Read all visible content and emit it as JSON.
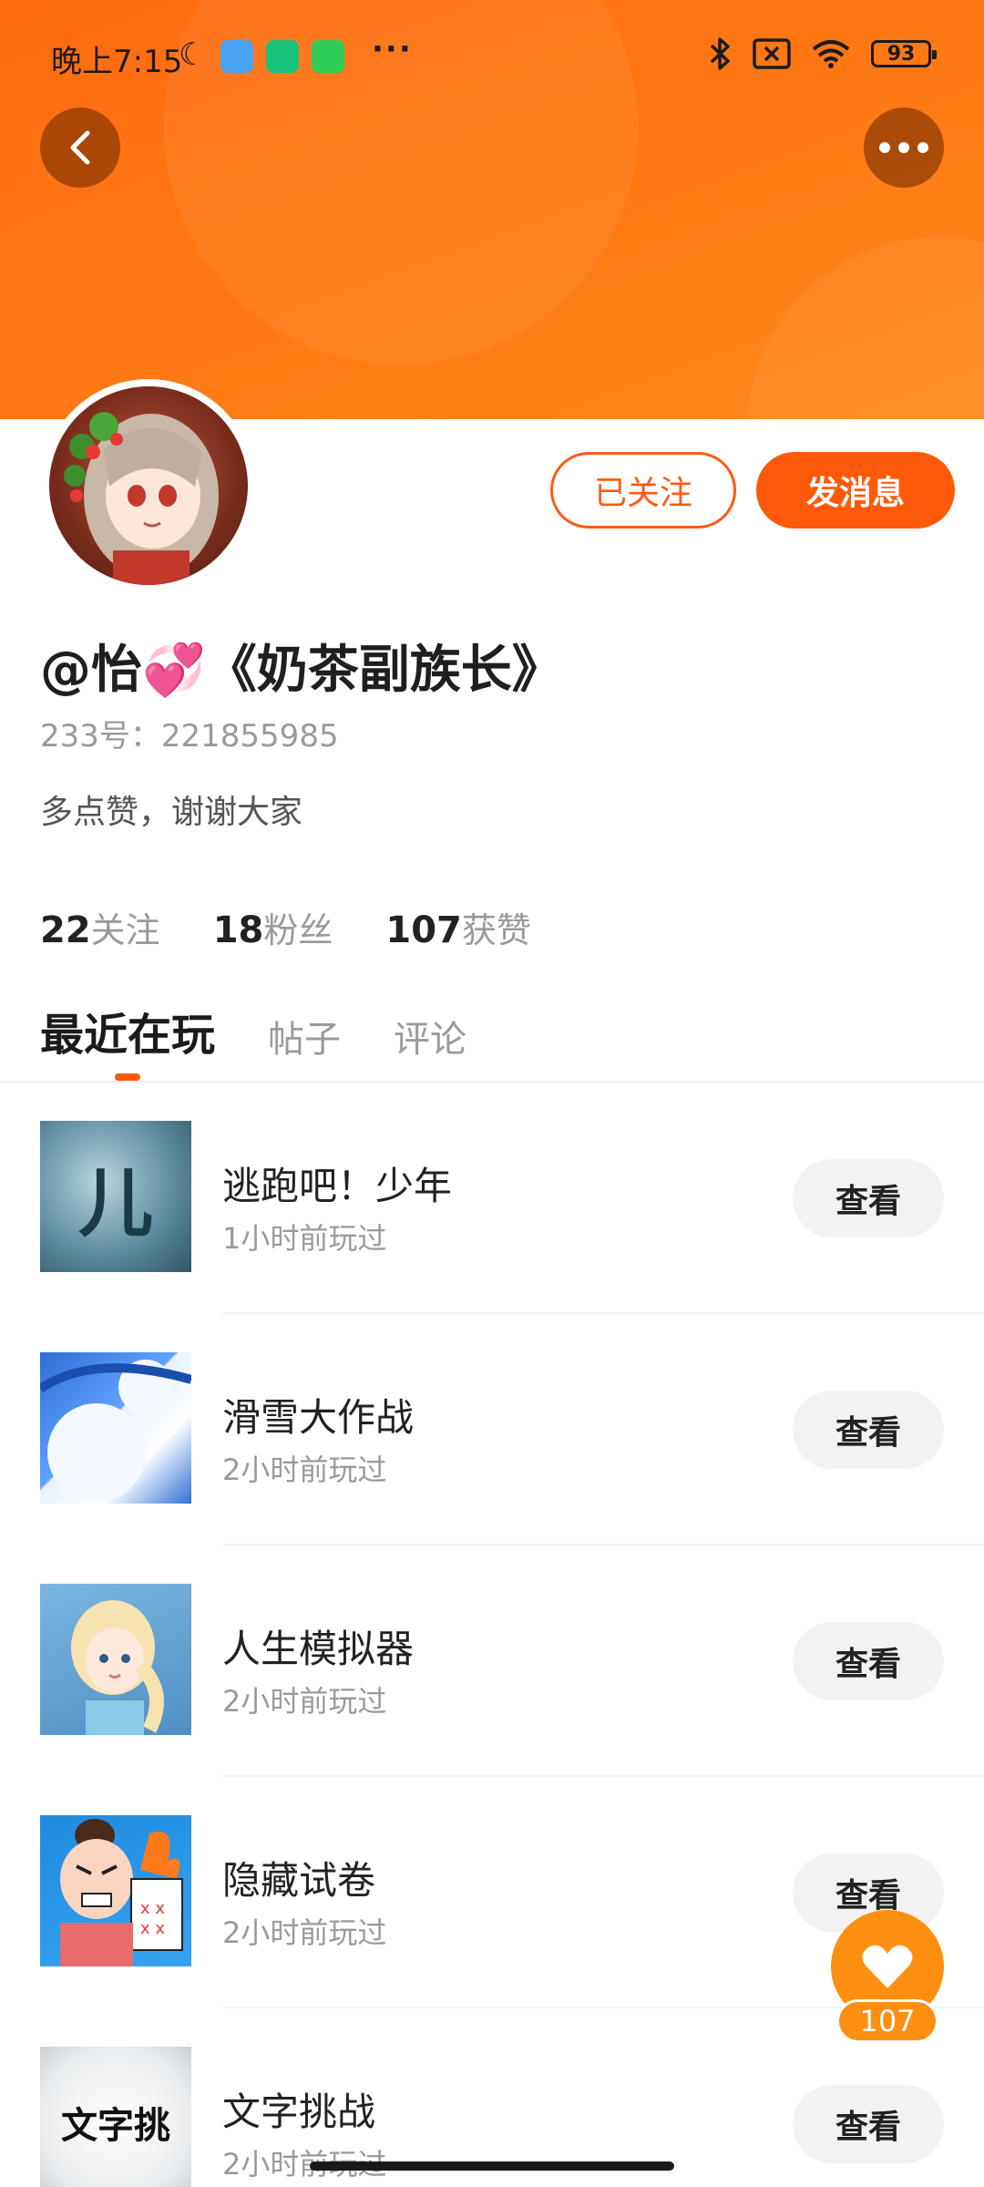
{
  "status_bar": {
    "time": "晚上7:15",
    "battery": "93"
  },
  "profile": {
    "username": "@怡💞《奶茶副族长》",
    "uid": "233号：221855985",
    "bio": "多点赞，谢谢大家",
    "followed_label": "已关注",
    "message_label": "发消息"
  },
  "stats": [
    {
      "num": "22",
      "label": "关注"
    },
    {
      "num": "18",
      "label": "粉丝"
    },
    {
      "num": "107",
      "label": "获赞"
    }
  ],
  "tabs": [
    {
      "label": "最近在玩",
      "active": true
    },
    {
      "label": "帖子",
      "active": false
    },
    {
      "label": "评论",
      "active": false
    }
  ],
  "games": [
    {
      "title": "逃跑吧！少年",
      "last_played": "1小时前玩过",
      "action": "查看",
      "thumb_text": "儿"
    },
    {
      "title": "滑雪大作战",
      "last_played": "2小时前玩过",
      "action": "查看",
      "thumb_text": ""
    },
    {
      "title": "人生模拟器",
      "last_played": "2小时前玩过",
      "action": "查看",
      "thumb_text": ""
    },
    {
      "title": "隐藏试卷",
      "last_played": "2小时前玩过",
      "action": "查看",
      "thumb_text": ""
    },
    {
      "title": "文字挑战",
      "last_played": "2小时前玩过",
      "action": "查看",
      "thumb_text": "文字挑"
    }
  ],
  "floating_like": {
    "count": "107"
  },
  "colors": {
    "accent": "#ff5a0a",
    "banner": "#ff7a14",
    "float": "#ff8f10"
  }
}
